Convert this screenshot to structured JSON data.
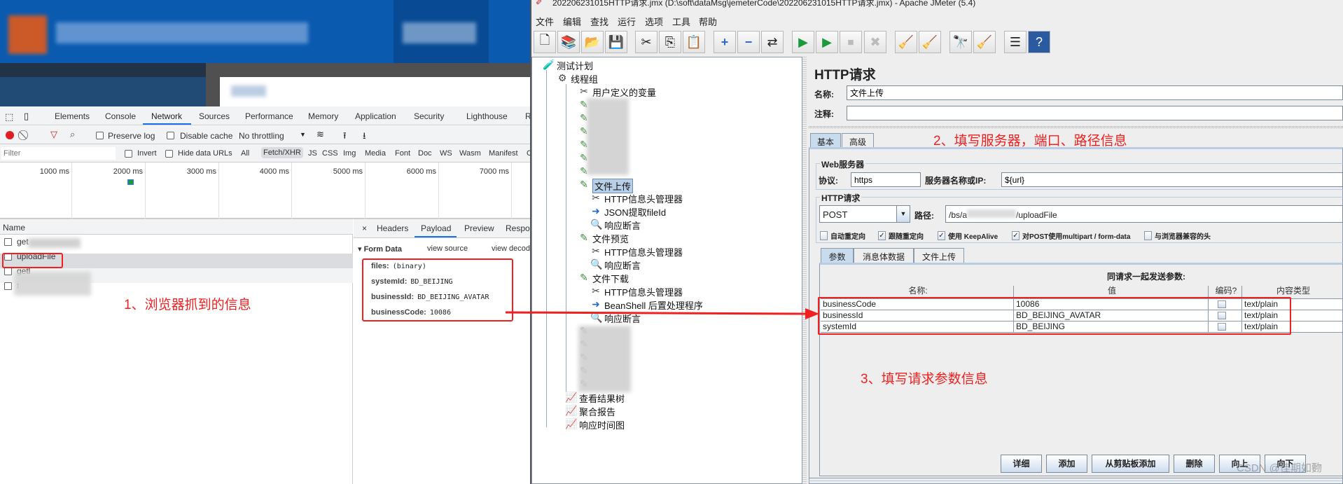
{
  "browser": {
    "devtools_tabs": [
      "Elements",
      "Console",
      "Network",
      "Sources",
      "Performance",
      "Memory",
      "Application",
      "Security",
      "Lighthouse",
      "Re"
    ],
    "active_tab": "Network",
    "toolbar": {
      "preserve_log": "Preserve log",
      "disable_cache": "Disable cache",
      "throttling": "No throttling"
    },
    "filter": {
      "placeholder": "Filter",
      "invert": "Invert",
      "hide_data_urls": "Hide data URLs",
      "types": [
        "All",
        "Fetch/XHR",
        "JS",
        "CSS",
        "Img",
        "Media",
        "Font",
        "Doc",
        "WS",
        "Wasm",
        "Manifest",
        "O"
      ],
      "active_type": "Fetch/XHR"
    },
    "timeline": [
      "1000 ms",
      "2000 ms",
      "3000 ms",
      "4000 ms",
      "5000 ms",
      "6000 ms",
      "7000 ms"
    ],
    "list_header": "Name",
    "requests": [
      "get",
      "uploadFile",
      "getl",
      "t"
    ],
    "detail_tabs": [
      "×",
      "Headers",
      "Payload",
      "Preview",
      "Respon"
    ],
    "active_detail_tab": "Payload",
    "form_data": {
      "title": "Form Data",
      "view_source": "view source",
      "view_decoded": "view decod",
      "fields": [
        {
          "k": "files:",
          "v": "(binary)"
        },
        {
          "k": "systemId:",
          "v": "BD_BEIJING"
        },
        {
          "k": "businessId:",
          "v": "BD_BEIJING_AVATAR"
        },
        {
          "k": "businessCode:",
          "v": "10086"
        }
      ]
    }
  },
  "annotations": {
    "a1": "1、浏览器抓到的信息",
    "a2": "2、填写服务器，端口、路径信息",
    "a3": "3、填写请求参数信息",
    "accent": "#f02020"
  },
  "jmeter": {
    "title": "202206231015HTTP请求.jmx (D:\\soft\\dataMsg\\jemeterCode\\202206231015HTTP请求.jmx) - Apache JMeter (5.4)",
    "menu": [
      "文件",
      "编辑",
      "查找",
      "运行",
      "选项",
      "工具",
      "帮助"
    ],
    "tree": {
      "plan": "测试计划",
      "group": "线程组",
      "vars": "用户定义的变量",
      "upload": "文件上传",
      "header": "HTTP信息头管理器",
      "json": "JSON提取fileId",
      "assert": "响应断言",
      "preview": "文件预览",
      "download": "文件下载",
      "beanshell": "BeanShell 后置处理程序",
      "results": "查看结果树",
      "aggregate": "聚合报告",
      "rtgraph": "响应时间图"
    },
    "panel": {
      "title": "HTTP请求",
      "name_label": "名称:",
      "name_value": "文件上传",
      "comment_label": "注释:",
      "comment_value": "",
      "tabs": [
        "基本",
        "高级"
      ],
      "web_server": "Web服务器",
      "protocol_label": "协议:",
      "protocol": "https",
      "server_label": "服务器名称或IP:",
      "server": "${url}",
      "http_request": "HTTP请求",
      "method": "POST",
      "path_label": "路径:",
      "path_prefix": "/bs/a",
      "path_suffix": "/uploadFile",
      "checkboxes": [
        {
          "label": "自动重定向",
          "checked": false
        },
        {
          "label": "跟随重定向",
          "checked": true
        },
        {
          "label": "使用 KeepAlive",
          "checked": true
        },
        {
          "label": "对POST使用multipart / form-data",
          "checked": true
        },
        {
          "label": "与浏览器兼容的头",
          "checked": false
        }
      ],
      "sub_tabs": [
        "参数",
        "消息体数据",
        "文件上传"
      ],
      "params_title": "同请求一起发送参数:",
      "columns": [
        "名称:",
        "值",
        "编码?",
        "内容类型"
      ],
      "rows": [
        {
          "name": "businessCode",
          "value": "10086",
          "encode": false,
          "type": "text/plain"
        },
        {
          "name": "businessId",
          "value": "BD_BEIJING_AVATAR",
          "encode": false,
          "type": "text/plain"
        },
        {
          "name": "systemId",
          "value": "BD_BEIJING",
          "encode": false,
          "type": "text/plain"
        }
      ],
      "buttons": [
        "详细",
        "添加",
        "从剪贴板添加",
        "删除",
        "向上",
        "向下"
      ]
    },
    "watermark": "CSDN @佳期如覅"
  }
}
